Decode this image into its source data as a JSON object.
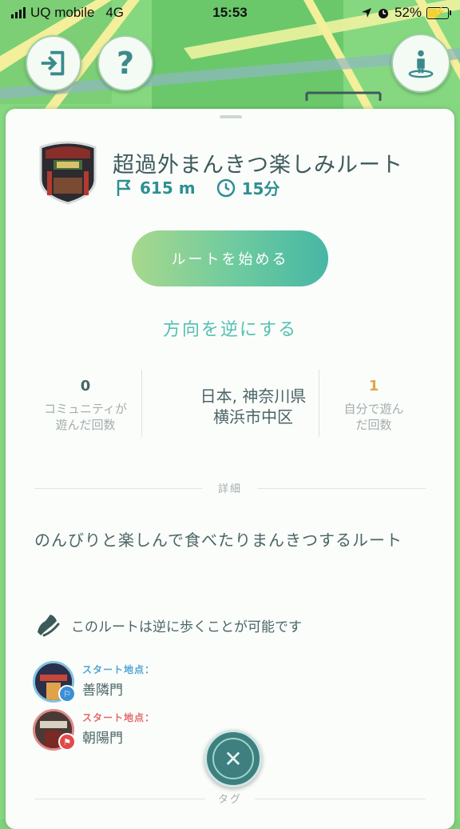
{
  "status_bar": {
    "carrier": "UQ mobile",
    "network": "4G",
    "time": "15:53",
    "battery": "52%",
    "battery_level": 0.52
  },
  "route": {
    "title": "超過外まんきつ楽しみルート",
    "distance": "615 m",
    "duration": "15分",
    "start_button": "ルートを始める",
    "reverse_link": "方向を逆にする"
  },
  "stats": {
    "community_count": "0",
    "community_label_1": "コミュニティが",
    "community_label_2": "遊んだ回数",
    "location_1": "日本, 神奈川県",
    "location_2": "横浜市中区",
    "self_count": "1",
    "self_label_1": "自分で遊ん",
    "self_label_2": "だ回数"
  },
  "details": {
    "heading": "詳細",
    "description": "のんびりと楽しんで食べたりまんきつするルート",
    "reversible_text": "このルートは逆に歩くことが可能です",
    "waypoints": [
      {
        "caption": "スタート地点：",
        "name": "善隣門"
      },
      {
        "caption": "スタート地点：",
        "name": "朝陽門"
      }
    ]
  },
  "tags": {
    "heading": "タグ"
  },
  "colors": {
    "accent": "#2e8f93",
    "map_green": "#86d880",
    "start_gradient_a": "#a7d88d",
    "start_gradient_b": "#47b7a4",
    "self_count": "#e2a64a"
  },
  "icons": [
    "exit-icon",
    "help-icon",
    "avatar-icon",
    "flag-icon",
    "clock-icon",
    "shoe-icon",
    "close-icon"
  ]
}
